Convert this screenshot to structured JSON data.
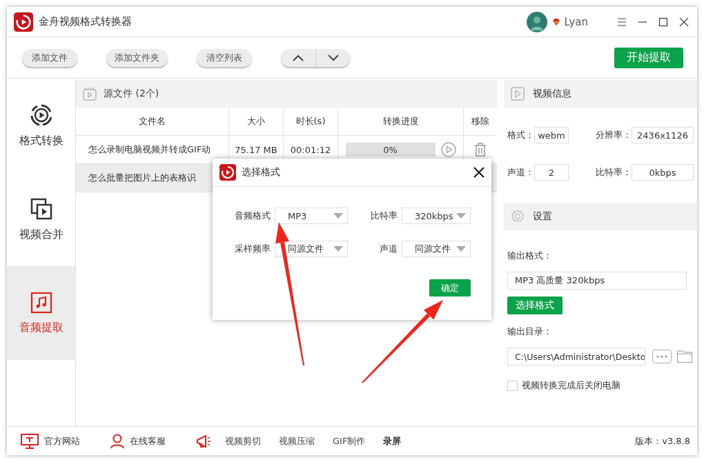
{
  "window": {
    "title": "金舟视频格式转换器",
    "user": "Lyan"
  },
  "toolbar": {
    "buttons": [
      "添加文件",
      "添加文件夹",
      "清空列表"
    ],
    "primary_button": "开始提取"
  },
  "sidebar": {
    "items": [
      {
        "label": "格式转换",
        "kind": "convert",
        "selected": false
      },
      {
        "label": "视频合并",
        "kind": "merge",
        "selected": false
      },
      {
        "label": "音频提取",
        "kind": "audio",
        "selected": true
      }
    ]
  },
  "file_list": {
    "title": "源文件 (2个)",
    "columns": [
      "文件名",
      "大小",
      "时长(s)",
      "转换进度",
      "移除"
    ],
    "rows": [
      {
        "name": "怎么录制电脑视频并转成GIF动",
        "size": "75.17 MB",
        "duration": "00:01:12",
        "progress": {
          "level": 0,
          "reading": "0%"
        },
        "selected": false
      },
      {
        "name": "怎么批量把图片上的表格识",
        "selected": true
      }
    ]
  },
  "video_info": {
    "title": "视频信息",
    "fields": [
      {
        "label": "格式：",
        "value": "webm"
      },
      {
        "label": "分辨率：",
        "value": "2436x1126"
      },
      {
        "label": "声道：",
        "value": "2"
      },
      {
        "label": "比特率：",
        "value": "0kbps"
      }
    ]
  },
  "settings": {
    "title": "设置",
    "output_format_label": "输出格式：",
    "output_format": "MP3 高质量 320kbps",
    "choose_button": "选择格式",
    "output_dir_label": "输出目录：",
    "output_dir": "C:\\Users\\Administrator\\Deskto",
    "shutdown": {
      "label": "视频转换完成后关闭电脑",
      "checked": false
    }
  },
  "footer": {
    "links": [
      {
        "label": "官方网站",
        "kind": "site"
      },
      {
        "label": "在线客服",
        "kind": "support"
      }
    ],
    "tools": [
      {
        "label": "视频剪切",
        "bold": false
      },
      {
        "label": "视频压缩",
        "bold": false
      },
      {
        "label": "GIF制作",
        "bold": false
      },
      {
        "label": "录屏",
        "bold": true
      }
    ],
    "version": "版本：v3.8.8"
  },
  "dialog": {
    "title": "选择格式",
    "fields": [
      {
        "label": "音频格式",
        "value": "MP3"
      },
      {
        "label": "比特率",
        "value": "320kbps"
      },
      {
        "label": "采样频率",
        "value": "同源文件"
      },
      {
        "label": "声道",
        "value": "同源文件"
      }
    ],
    "confirm": "确定"
  }
}
